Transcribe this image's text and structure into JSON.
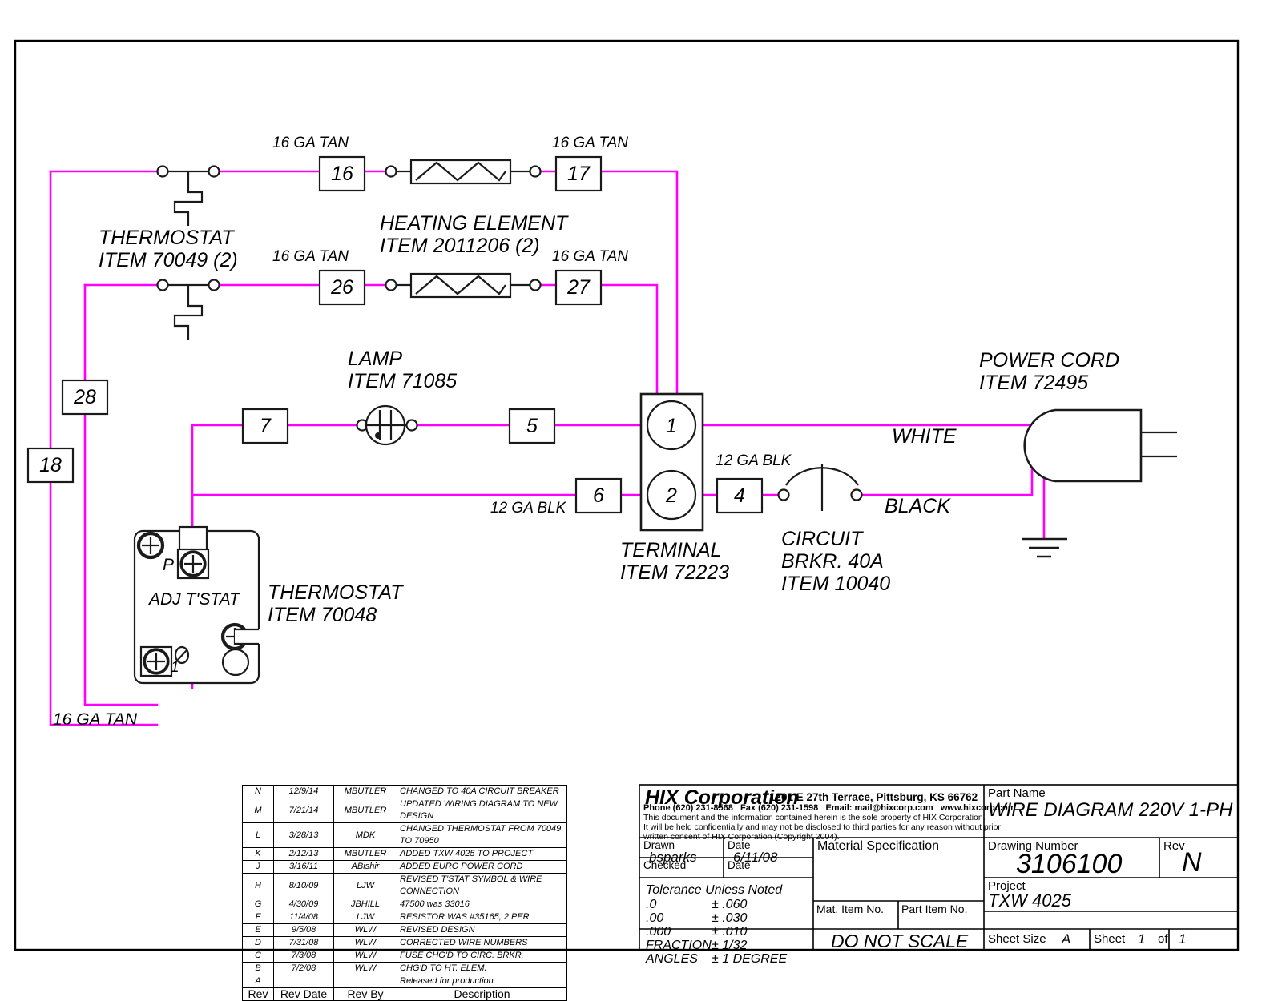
{
  "drawing": {
    "colors": {
      "wire": "#ff00ff",
      "line": "#1a1a1a",
      "border": "#000000"
    },
    "components": [
      {
        "id": "thermostat-upper",
        "label_line1": "THERMOSTAT",
        "label_line2": "ITEM 70049 (2)"
      },
      {
        "id": "heating-element",
        "label_line1": "HEATING ELEMENT",
        "label_line2": "ITEM 2011206 (2)"
      },
      {
        "id": "lamp",
        "label_line1": "LAMP",
        "label_line2": "ITEM 71085"
      },
      {
        "id": "terminal",
        "label_line1": "TERMINAL",
        "label_line2": "ITEM 72223"
      },
      {
        "id": "circuit-breaker",
        "label_line1": "CIRCUIT",
        "label_line2": "BRKR. 40A",
        "label_line3": "ITEM 10040"
      },
      {
        "id": "power-cord",
        "label_line1": "POWER CORD",
        "label_line2": "ITEM 72495"
      },
      {
        "id": "adj-thermostat",
        "label_line1": "THERMOSTAT",
        "label_line2": "ITEM 70048"
      }
    ],
    "adj_tstat": {
      "body_label": "ADJ T'STAT",
      "terminal_p": "P",
      "terminal_1": "1"
    },
    "wire_numbers": {
      "n16": "16",
      "n17": "17",
      "n26": "26",
      "n27": "27",
      "n7": "7",
      "n5": "5",
      "n6": "6",
      "n4": "4",
      "n28": "28",
      "n18": "18",
      "t1": "1",
      "t2": "2"
    },
    "gauge_labels": {
      "top_left": "16 GA TAN",
      "top_right": "16 GA TAN",
      "mid_left": "16 GA TAN",
      "mid_right": "16 GA TAN",
      "blk_6": "12 GA BLK",
      "blk_4": "12 GA BLK",
      "bottom_tan": "16 GA TAN"
    },
    "conductor_labels": {
      "white": "WHITE",
      "black": "BLACK"
    }
  },
  "revisions": {
    "headers": [
      "Rev",
      "Rev Date",
      "Rev By",
      "Description"
    ],
    "rows": [
      {
        "rev": "N",
        "date": "12/9/14",
        "by": "MBUTLER",
        "desc": "CHANGED TO 40A CIRCUIT BREAKER"
      },
      {
        "rev": "M",
        "date": "7/21/14",
        "by": "MBUTLER",
        "desc": "UPDATED WIRING DIAGRAM TO NEW DESIGN"
      },
      {
        "rev": "L",
        "date": "3/28/13",
        "by": "MDK",
        "desc": "CHANGED THERMOSTAT FROM 70049 TO 70950"
      },
      {
        "rev": "K",
        "date": "2/12/13",
        "by": "MBUTLER",
        "desc": "ADDED TXW 4025 TO PROJECT"
      },
      {
        "rev": "J",
        "date": "3/16/11",
        "by": "ABishir",
        "desc": "ADDED EURO POWER CORD"
      },
      {
        "rev": "H",
        "date": "8/10/09",
        "by": "LJW",
        "desc": "REVISED T'STAT SYMBOL & WIRE CONNECTION"
      },
      {
        "rev": "G",
        "date": "4/30/09",
        "by": "JBHILL",
        "desc": "47500 was 33016"
      },
      {
        "rev": "F",
        "date": "11/4/08",
        "by": "LJW",
        "desc": "RESISTOR WAS #35165, 2 PER"
      },
      {
        "rev": "E",
        "date": "9/5/08",
        "by": "WLW",
        "desc": "REVISED DESIGN"
      },
      {
        "rev": "D",
        "date": "7/31/08",
        "by": "WLW",
        "desc": "CORRECTED WIRE NUMBERS"
      },
      {
        "rev": "C",
        "date": "7/3/08",
        "by": "WLW",
        "desc": "FUSE CHG'D TO CIRC. BRKR."
      },
      {
        "rev": "B",
        "date": "7/2/08",
        "by": "WLW",
        "desc": "CHG'D TO HT. ELEM."
      },
      {
        "rev": "A",
        "date": "",
        "by": "",
        "desc": "Released for production."
      }
    ]
  },
  "titleblock": {
    "company": "HIX Corporation",
    "address": "1201 E 27th Terrace, Pittsburg, KS 66762",
    "contact": "Phone (620) 231-8568   Fax (620) 231-1598   Email: mail@hixcorp.com   www.hixcorp.com",
    "legal_line1": "This document and the information contained herein is the sole property of HIX Corporation.",
    "legal_line2": "It will be held confidentially and may not be disclosed to third parties for any reason without prior",
    "legal_line3": "written consent of HIX Corporation (Copyright 2004).",
    "drawn_label": "Drawn",
    "drawn_value": "bsparks",
    "date_label": "Date",
    "date_value": "6/11/08",
    "checked_label": "Checked",
    "checked_date_label": "Date",
    "tolerance_title": "Tolerance Unless Noted",
    "tol_rows": [
      {
        "k": ".0",
        "v": "± .060"
      },
      {
        "k": ".00",
        "v": "± .030"
      },
      {
        "k": ".000",
        "v": "± .010"
      },
      {
        "k": "FRACTION",
        "v": "± 1/32"
      },
      {
        "k": "ANGLES",
        "v": "± 1 DEGREE"
      }
    ],
    "material_spec_label": "Material Specification",
    "mat_item_label": "Mat. Item No.",
    "part_item_label": "Part Item No.",
    "do_not_scale": "DO NOT SCALE",
    "part_name_label": "Part Name",
    "part_name_value": "WIRE DIAGRAM 220V 1-PH",
    "drawing_number_label": "Drawing Number",
    "drawing_number_value": "3106100",
    "rev_label": "Rev",
    "rev_value": "N",
    "project_label": "Project",
    "project_value": "TXW 4025",
    "sheet_size_label": "Sheet Size",
    "sheet_size_value": "A",
    "sheet_label": "Sheet",
    "sheet_number": "1",
    "sheet_of": "of",
    "sheet_total": "1"
  }
}
